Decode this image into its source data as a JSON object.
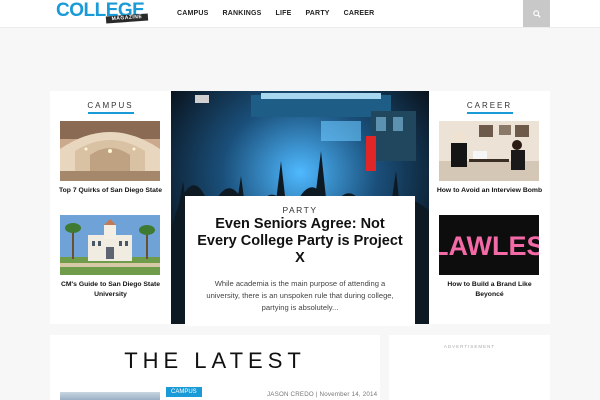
{
  "header": {
    "logo_text": "COLLEGE",
    "logo_sub": "MAGAZINE",
    "nav": [
      "CAMPUS",
      "RANKINGS",
      "LIFE",
      "PARTY",
      "CAREER"
    ]
  },
  "left_column": {
    "title": "CAMPUS",
    "items": [
      {
        "caption": "Top 7 Quirks of San Diego State"
      },
      {
        "caption": "CM's Guide to San Diego State University"
      }
    ]
  },
  "right_column": {
    "title": "CAREER",
    "items": [
      {
        "caption": "How to Avoid an Interview Bomb"
      },
      {
        "caption": "How to Build a Brand Like Beyoncé",
        "image_text": "FLAWLESS"
      }
    ]
  },
  "feature": {
    "category": "PARTY",
    "title": "Even Seniors Agree: Not Every College Party is Project X",
    "excerpt": "While academia is the main purpose of attending a university, there is an unspoken rule that during college, partying is absolutely..."
  },
  "latest": {
    "title": "THE LATEST",
    "category": "CAMPUS",
    "meta": "JASON CREDO | November 14, 2014"
  },
  "ad": {
    "label": "ADVERTISEMENT"
  },
  "colors": {
    "accent": "#1a9ad6",
    "search_bg": "#c8c8c8"
  },
  "icons": [
    "search-icon"
  ]
}
